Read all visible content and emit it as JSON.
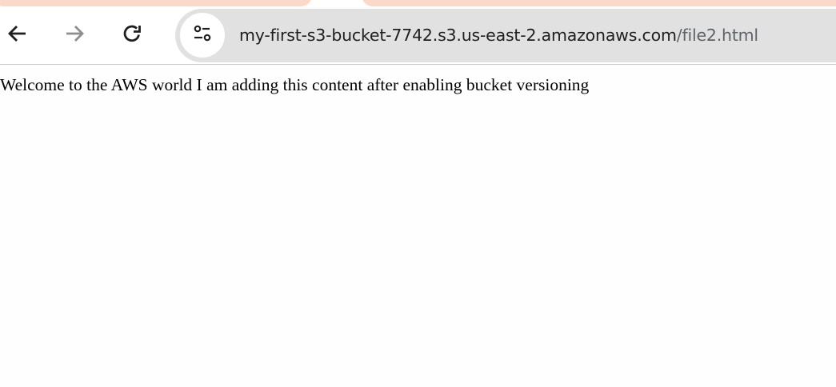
{
  "browser": {
    "tab_accent_color": "#fbd9c8",
    "toolbar": {
      "back_icon": "arrow-left-icon",
      "forward_icon": "arrow-right-icon",
      "reload_icon": "reload-icon",
      "site_info_icon": "tune-icon"
    },
    "address_bar": {
      "url_host": "my-first-s3-bucket-7742.s3.us-east-2.amazonaws.com",
      "url_path": "/file2.html"
    }
  },
  "page": {
    "body_text": "Welcome to the AWS world I am adding this content after enabling bucket versioning"
  }
}
